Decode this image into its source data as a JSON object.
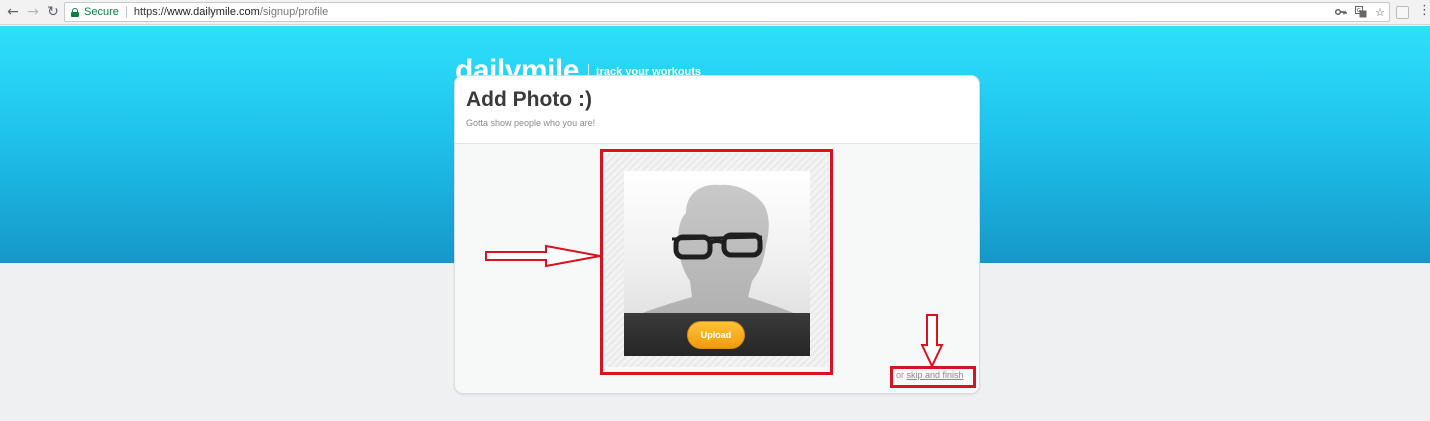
{
  "browser": {
    "secure_label": "Secure",
    "url_prefix": "https://",
    "url_host": "www.dailymile.com",
    "url_path": "/signup/profile"
  },
  "header": {
    "logo": "dailymile",
    "tagline": "track your workouts"
  },
  "card": {
    "title": "Add Photo :)",
    "subtitle": "Gotta show people who you are!",
    "upload_label": "Upload",
    "skip_prefix": "or",
    "skip_link": "skip and finish"
  },
  "colors": {
    "hero_top": "#2ee0fb",
    "hero_bottom": "#1697ca",
    "upload_orange": "#f5a623",
    "annotation_red": "#d9121e"
  }
}
